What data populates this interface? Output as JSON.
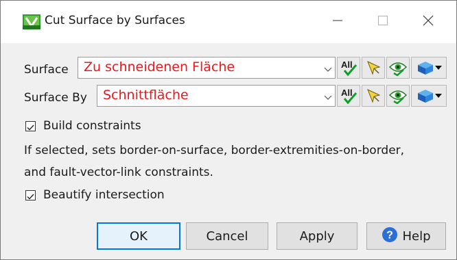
{
  "window": {
    "title": "Cut Surface by Surfaces"
  },
  "controls": {
    "minimize": "—",
    "maximize": "☐",
    "close": "✕"
  },
  "surface": {
    "label": "Surface",
    "value": "Zu schneidenen Fläche"
  },
  "surface_by": {
    "label": "Surface By",
    "value": "Schnittfläche"
  },
  "tools": {
    "all_label": "All"
  },
  "build_constraints": {
    "label": "Build constraints",
    "checked": true
  },
  "description": {
    "line1": "If selected, sets border-on-surface, border-extremities-on-border,",
    "line2": "and fault-vector-link constraints."
  },
  "beautify": {
    "label": "Beautify intersection",
    "checked": true
  },
  "buttons": {
    "ok": "OK",
    "cancel": "Cancel",
    "apply": "Apply",
    "help": "Help"
  },
  "colors": {
    "value_text": "#e8181d",
    "default_button_border": "#0078d7",
    "all_icon": "#0b9e2a",
    "help_icon": "#2a6fd6"
  },
  "icons": [
    "app-icon",
    "minimize-icon",
    "maximize-icon",
    "close-icon",
    "all-icon",
    "pick-cursor-icon",
    "eye-icon",
    "cube-icon",
    "dropdown-arrow-icon",
    "help-icon"
  ]
}
